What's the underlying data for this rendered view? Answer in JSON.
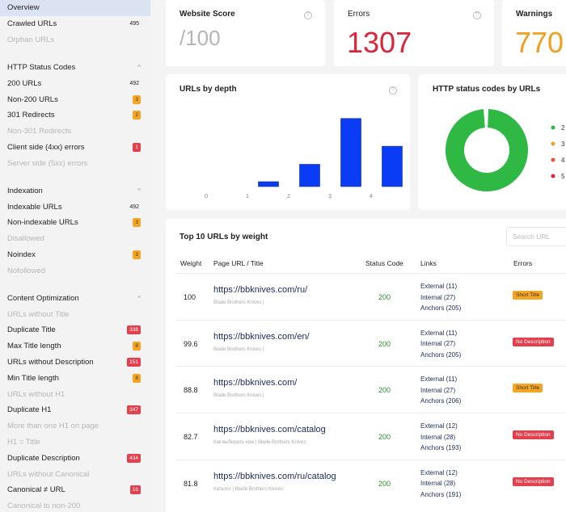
{
  "sidebar": {
    "top_items": [
      {
        "label": "Overview",
        "active": true
      },
      {
        "label": "Crawled URLs",
        "count": "495"
      },
      {
        "label": "Orphan URLs",
        "muted": true
      }
    ],
    "groups": [
      {
        "title": "HTTP Status Codes",
        "caret": "^",
        "items": [
          {
            "label": "200 URLs",
            "count": "492"
          },
          {
            "label": "Non-200 URLs",
            "badge": "3",
            "badge_color": "orange"
          },
          {
            "label": "301 Redirects",
            "badge": "2",
            "badge_color": "orange"
          },
          {
            "label": "Non-301 Redirects",
            "muted": true
          },
          {
            "label": "Client side (4xx) errors",
            "badge": "1",
            "badge_color": "red"
          },
          {
            "label": "Server side (5xx) errors",
            "muted": true
          }
        ]
      },
      {
        "title": "Indexation",
        "caret": "^",
        "items": [
          {
            "label": "Indexable URLs",
            "count": "492"
          },
          {
            "label": "Non-indexable URLs",
            "badge": "3",
            "badge_color": "orange"
          },
          {
            "label": "Disallowed",
            "muted": true
          },
          {
            "label": "Noindex",
            "badge": "3",
            "badge_color": "orange"
          },
          {
            "label": "Nofollowed",
            "muted": true
          }
        ]
      },
      {
        "title": "Content Optimization",
        "caret": "^",
        "items": [
          {
            "label": "URLs without Title",
            "muted": true
          },
          {
            "label": "Duplicate Title",
            "badge": "338",
            "badge_color": "red"
          },
          {
            "label": "Max Title length",
            "badge": "8",
            "badge_color": "orange"
          },
          {
            "label": "URLs without Description",
            "badge": "151",
            "badge_color": "red"
          },
          {
            "label": "Min Title length",
            "badge": "8",
            "badge_color": "orange"
          },
          {
            "label": "URLs without H1",
            "muted": true
          },
          {
            "label": "Duplicate H1",
            "badge": "347",
            "badge_color": "red"
          },
          {
            "label": "More than one H1 on page",
            "muted": true
          },
          {
            "label": "H1 = Title",
            "muted": true
          },
          {
            "label": "Duplicate Description",
            "badge": "434",
            "badge_color": "red"
          },
          {
            "label": "URLs without Canonical",
            "muted": true
          },
          {
            "label": "Canonical ≠ URL",
            "badge": "16",
            "badge_color": "red"
          },
          {
            "label": "Canonical to non-200",
            "muted": true
          }
        ]
      }
    ]
  },
  "score_cards": {
    "website_score": {
      "title": "Website Score",
      "value": "/100",
      "help": "?"
    },
    "errors": {
      "title": "Errors",
      "value": "1307",
      "help": "?"
    },
    "warnings": {
      "title": "Warnings",
      "value": "770"
    }
  },
  "colors": {
    "errors": "#d9263a",
    "warnings": "#f0a020",
    "score": "#b5b5b5",
    "bar": "#0a3cf5",
    "donut_green": "#2fb844",
    "status_ok": "#2e8b2e",
    "link": "#1b2b5a"
  },
  "depth_chart": {
    "title": "URLs by depth",
    "help": "?"
  },
  "status_chart": {
    "title": "HTTP status codes by URLs",
    "legend": [
      {
        "label": "2",
        "color": "#2fb844"
      },
      {
        "label": "3",
        "color": "#f0a020"
      },
      {
        "label": "4",
        "color": "#e0573a"
      },
      {
        "label": "5",
        "color": "#d9263a"
      }
    ]
  },
  "chart_data": [
    {
      "type": "bar",
      "title": "URLs by depth",
      "categories": [
        "0",
        "1",
        "2",
        "3",
        "4"
      ],
      "values": [
        0,
        35,
        160,
        490,
        290
      ],
      "xlabel": "",
      "ylabel": "",
      "ylim": [
        0,
        500
      ],
      "grid": false,
      "note": "no y-axis shown; values estimated relative to bar heights"
    },
    {
      "type": "pie",
      "title": "HTTP status codes by URLs",
      "donut": true,
      "categories": [
        "2",
        "3",
        "4",
        "5"
      ],
      "values": [
        492,
        2,
        1,
        0
      ],
      "legend": "right"
    }
  ],
  "top_urls": {
    "title": "Top 10 URLs by weight",
    "search_placeholder": "Search URL",
    "columns": [
      "Weight",
      "Page URL / Title",
      "Status Code",
      "Links",
      "Errors"
    ],
    "rows": [
      {
        "weight": "100",
        "url": "https://bbknives.com/ru/",
        "title": "Blade Brothers Knives |",
        "status": "200",
        "links": [
          "External (11)",
          "Internal (27)",
          "Anchors (205)"
        ],
        "error": "Short Title",
        "error_color": "orange"
      },
      {
        "weight": "99.6",
        "url": "https://bbknives.com/en/",
        "title": "Blade Brothers Knives |",
        "status": "200",
        "links": [
          "External (11)",
          "Internal (27)",
          "Anchors (205)"
        ],
        "error": "No Description",
        "error_color": "red"
      },
      {
        "weight": "88.8",
        "url": "https://bbknives.com/",
        "title": "Blade Brothers Knives |",
        "status": "200",
        "links": [
          "External (11)",
          "Internal (27)",
          "Anchors (206)"
        ],
        "error": "Short Title",
        "error_color": "orange"
      },
      {
        "weight": "82.7",
        "url": "https://bbknives.com/catalog",
        "title": "Как выбирать нож | Blade Brothers Knives",
        "status": "200",
        "links": [
          "External (12)",
          "Internal (28)",
          "Anchors (193)"
        ],
        "error": "No Description",
        "error_color": "red"
      },
      {
        "weight": "81.8",
        "url": "https://bbknives.com/ru/catalog",
        "title": "Каталог | Blade Brothers Knives",
        "status": "200",
        "links": [
          "External (12)",
          "Internal (28)",
          "Anchors (191)"
        ],
        "error": "No Description",
        "error_color": "red"
      }
    ]
  }
}
